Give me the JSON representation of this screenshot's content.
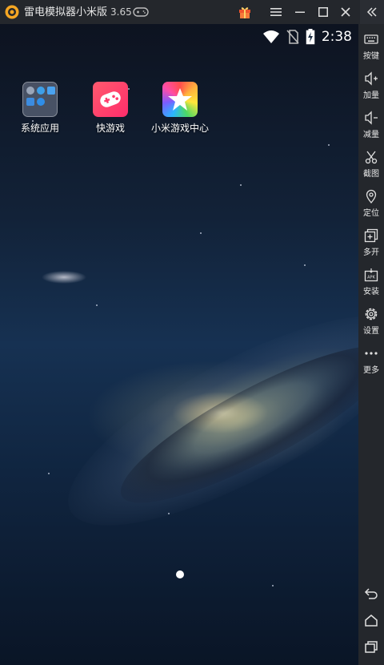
{
  "window": {
    "title": "雷电模拟器小米版",
    "version": "3.65"
  },
  "status_bar": {
    "time": "2:38"
  },
  "apps": [
    {
      "label": "系统应用"
    },
    {
      "label": "快游戏"
    },
    {
      "label": "小米游戏中心"
    }
  ],
  "sidebar": {
    "items": [
      {
        "label": "按键",
        "icon": "keyboard-icon"
      },
      {
        "label": "加量",
        "icon": "volume-up-icon"
      },
      {
        "label": "减量",
        "icon": "volume-down-icon"
      },
      {
        "label": "截图",
        "icon": "scissors-icon"
      },
      {
        "label": "定位",
        "icon": "location-pin-icon"
      },
      {
        "label": "多开",
        "icon": "multi-instance-icon"
      },
      {
        "label": "安装",
        "icon": "apk-install-icon"
      },
      {
        "label": "设置",
        "icon": "gear-icon"
      },
      {
        "label": "更多",
        "icon": "more-dots-icon"
      }
    ]
  },
  "colors": {
    "titlebar": "#24272c",
    "accent_logo": "#f5a623",
    "gift": "#f0542d"
  }
}
